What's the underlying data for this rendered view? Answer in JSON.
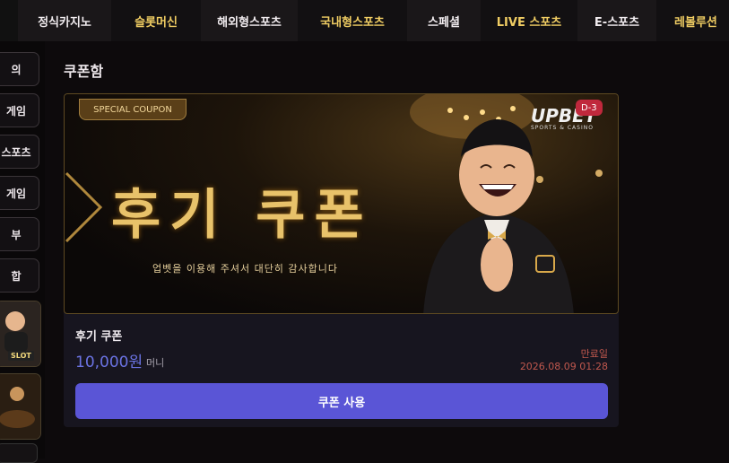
{
  "topnav": {
    "items": [
      "정식카지노",
      "슬롯머신",
      "해외형스포츠",
      "국내형스포츠",
      "스페셜",
      "LIVE 스포츠",
      "E-스포츠",
      "레볼루션"
    ]
  },
  "sidebar": {
    "items": [
      "의",
      "게임",
      "스포츠",
      "게임",
      "부",
      "합"
    ],
    "thumb_tag": "SLOT"
  },
  "page": {
    "title": "쿠폰함"
  },
  "coupon": {
    "banner_badge": "SPECIAL COUPON",
    "banner_title": "후기 쿠폰",
    "banner_subtitle": "업벳을 이용해 주셔서 대단히 감사합니다",
    "logo_text": "UPBET",
    "logo_sub": "SPORTS & CASINO",
    "day_tag": "D-3",
    "name": "후기 쿠폰",
    "amount": "10,000원",
    "unit": "머니",
    "expiry_label": "만료일",
    "expiry_date": "2026.08.09 01:28",
    "use_button": "쿠폰 사용"
  },
  "colors": {
    "accent": "#5a55d6",
    "amount": "#6b73e3",
    "expiry": "#c0584e",
    "nav_gold": "#f0cd63"
  }
}
